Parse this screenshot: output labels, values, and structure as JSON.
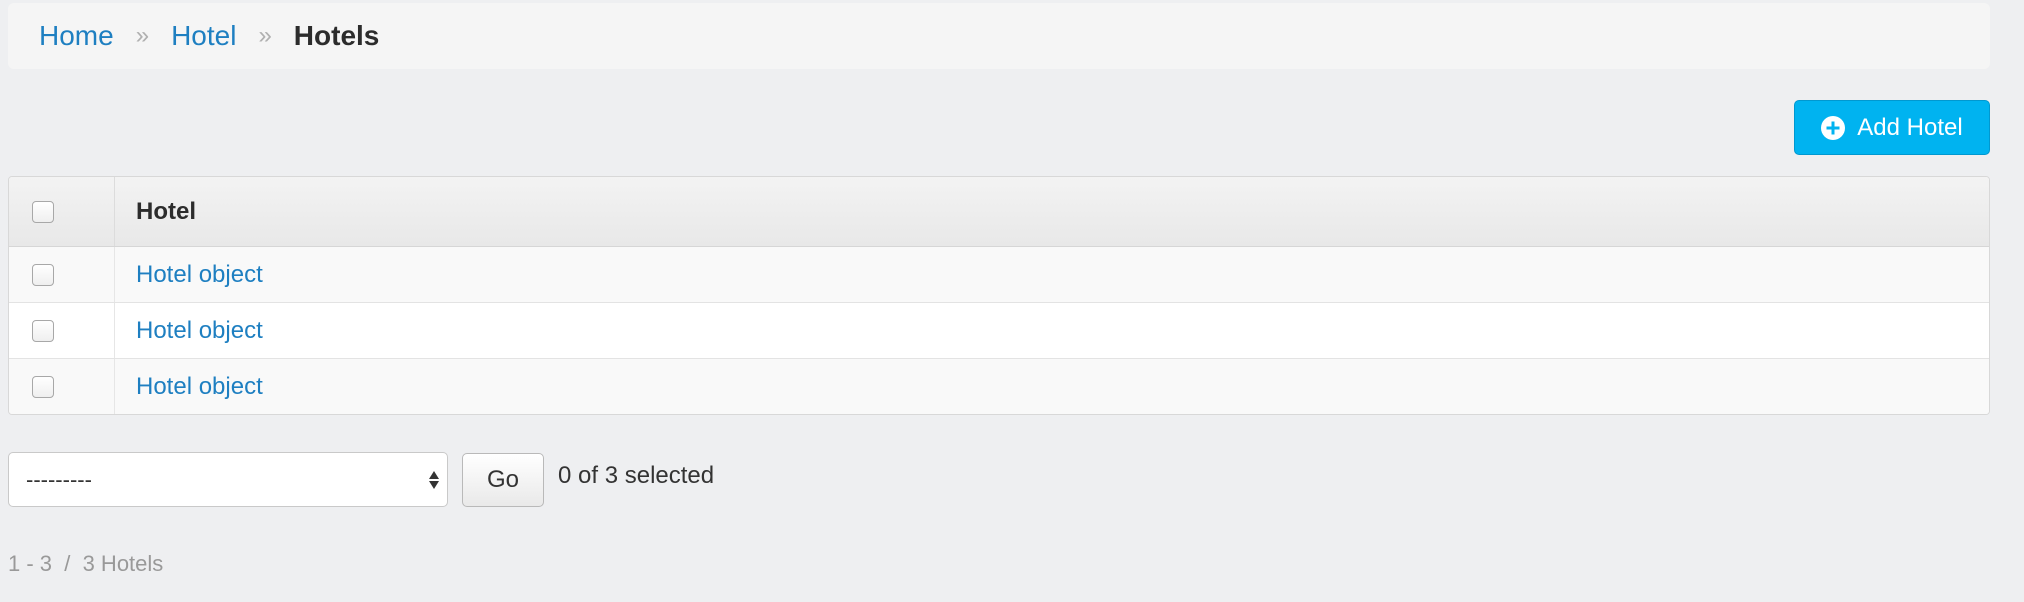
{
  "breadcrumb": {
    "items": [
      {
        "label": "Home"
      },
      {
        "label": "Hotel"
      }
    ],
    "separator": "»",
    "current": "Hotels"
  },
  "toolbar": {
    "add_label": "Add Hotel",
    "add_icon": "plus-circle-icon"
  },
  "table": {
    "column_header": "Hotel",
    "rows": [
      {
        "label": "Hotel object"
      },
      {
        "label": "Hotel object"
      },
      {
        "label": "Hotel object"
      }
    ]
  },
  "actions": {
    "selected_action": "---------",
    "go_label": "Go",
    "selected_count": "0 of 3 selected"
  },
  "paginator": {
    "text": "1 - 3  /  3 Hotels"
  },
  "colors": {
    "link": "#1e7fc1",
    "accent_button": "#00b3f0",
    "background": "#eeeff1"
  }
}
